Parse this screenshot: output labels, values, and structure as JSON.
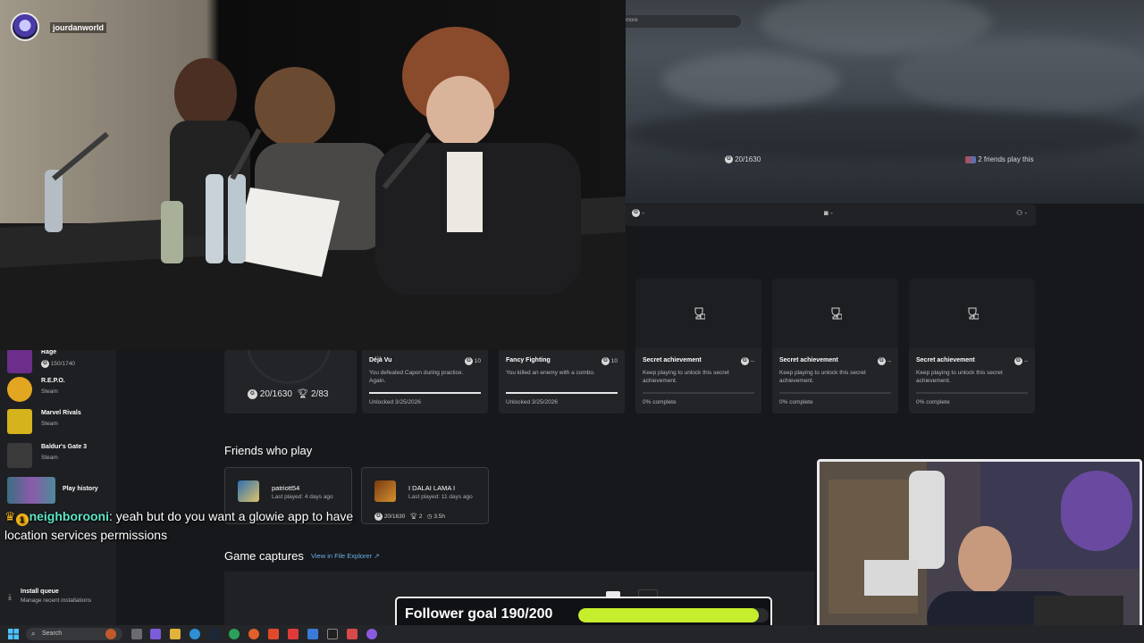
{
  "stream": {
    "streamer_name": "jourdanworld",
    "chat": {
      "user": "neighborooni",
      "badge_count": "1",
      "message": ": yeah but do you want a glowie app to have location services permissions"
    },
    "follower_goal": {
      "label": "Follower goal 190/200",
      "current": 190,
      "target": 200,
      "bar_color": "#c7ee2c"
    }
  },
  "hero": {
    "search_more": "more",
    "gamerscore": "20/1630",
    "friends_play": "2 friends play this"
  },
  "filters": [
    {
      "icon": "gamerscore-icon",
      "label": "G -"
    },
    {
      "icon": "camera-icon",
      "label": "-"
    },
    {
      "icon": "friends-icon",
      "label": "-"
    }
  ],
  "sidebar": {
    "items": [
      {
        "title": "Rage",
        "sub": "150/1740",
        "color": "#6d2d8a"
      },
      {
        "title": "R.E.P.O.",
        "sub": "Steam",
        "color": "#e2a620"
      },
      {
        "title": "Marvel Rivals",
        "sub": "Steam",
        "color": "#d4b31d"
      },
      {
        "title": "Baldur's Gate 3",
        "sub": "Steam",
        "color": "#3b3b3b"
      },
      {
        "title": "Play history",
        "sub": "",
        "color": "#4d8a9c"
      }
    ],
    "install_queue": {
      "title": "Install queue",
      "sub": "Manage recent installations"
    }
  },
  "game_card": {
    "gamerscore": "20/1630",
    "achievements": "2/83"
  },
  "achievements": [
    {
      "name": "Déjà Vu",
      "desc": "You defeated Capon during practice. Again.",
      "points": "10",
      "status": "Unlocked 3/25/2026",
      "progress": 1,
      "secret": false
    },
    {
      "name": "Fancy Fighting",
      "desc": "You killed an enemy with a combo.",
      "points": "10",
      "status": "Unlocked 3/25/2026",
      "progress": 1,
      "secret": false
    },
    {
      "name": "Secret achievement",
      "desc": "Keep playing to unlock this secret achievement.",
      "points": "--",
      "status": "0% complete",
      "progress": 0,
      "secret": true
    },
    {
      "name": "Secret achievement",
      "desc": "Keep playing to unlock this secret achievement.",
      "points": "--",
      "status": "0% complete",
      "progress": 0,
      "secret": true
    },
    {
      "name": "Secret achievement",
      "desc": "Keep playing to unlock this secret achievement.",
      "points": "--",
      "status": "0% complete",
      "progress": 0,
      "secret": true
    }
  ],
  "friends_section": {
    "title": "Friends who play",
    "friends": [
      {
        "name": "patriott54",
        "last_played": "Last played: 4 days ago",
        "stats": ""
      },
      {
        "name": "I DALAI LAMA I",
        "last_played": "Last played: 11 days ago",
        "gamerscore": "20/1630",
        "achievements": "2",
        "hours": "3.5h"
      }
    ]
  },
  "captures_section": {
    "title": "Game captures",
    "link": "View in File Explorer"
  },
  "taskbar": {
    "search_placeholder": "Search"
  }
}
